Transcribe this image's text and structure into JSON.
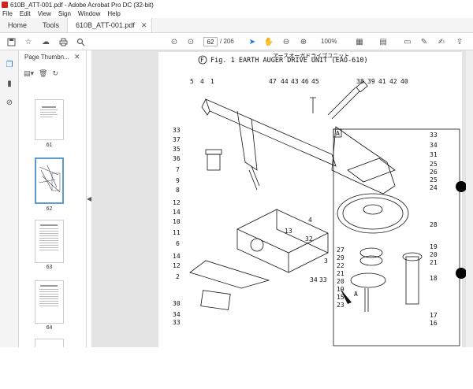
{
  "app": {
    "title": "610B_ATT-001.pdf - Adobe Acrobat Pro DC (32-bit)",
    "menu": [
      "File",
      "Edit",
      "View",
      "Sign",
      "Window",
      "Help"
    ],
    "accent": "#d2231c"
  },
  "tabs": {
    "home": "Home",
    "tools": "Tools",
    "document": "610B_ATT-001.pdf"
  },
  "toolbar": {
    "page_current": "62",
    "page_total": "/ 206",
    "zoom": "100%"
  },
  "thumbnails": {
    "title": "Page Thumbn...",
    "items": [
      {
        "label": "61"
      },
      {
        "label": "62"
      },
      {
        "label": "63"
      },
      {
        "label": "64"
      }
    ]
  },
  "diagram": {
    "title_jp": "アースオーガドライブユニット",
    "title": "Fig.  1   EARTH AUGER DRIVE UNIT (EAO-610)",
    "fig_letter": "F",
    "inset_label": "A",
    "arrow_label": "A",
    "callouts_left": [
      "5",
      "4",
      "1",
      "33",
      "37",
      "35",
      "36",
      "7",
      "9",
      "8",
      "12",
      "14",
      "10",
      "11",
      "6",
      "14",
      "12",
      "2",
      "30",
      "34",
      "33"
    ],
    "callouts_top": [
      "47",
      "44",
      "43",
      "46",
      "45",
      "38",
      "39",
      "41",
      "42",
      "40"
    ],
    "callouts_mid": [
      "4",
      "13",
      "32",
      "3",
      "34",
      "33"
    ],
    "callouts_inset": [
      "33",
      "34",
      "31",
      "25",
      "26",
      "25",
      "24",
      "28",
      "27",
      "29",
      "22",
      "21",
      "20",
      "19",
      "15",
      "23",
      "19",
      "20",
      "21",
      "18",
      "17",
      "16"
    ]
  }
}
